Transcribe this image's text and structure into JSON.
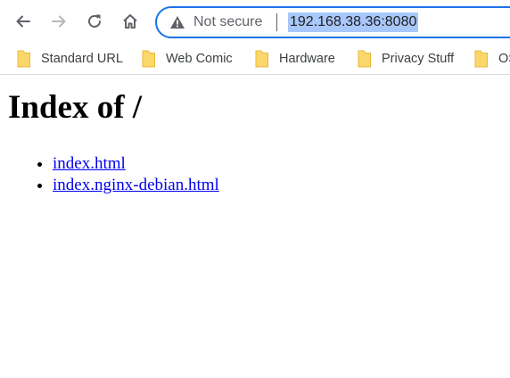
{
  "browser": {
    "security_label": "Not secure",
    "url": "192.168.38.36:8080",
    "accent_color": "#1a73e8",
    "icons": [
      "back-arrow-icon",
      "forward-arrow-icon",
      "reload-icon",
      "home-icon",
      "warning-triangle-icon",
      "folder-icon"
    ]
  },
  "bookmarks": [
    {
      "label": "Standard URL"
    },
    {
      "label": "Web Comic"
    },
    {
      "label": "Hardware"
    },
    {
      "label": "Privacy Stuff"
    },
    {
      "label": "OS"
    }
  ],
  "page": {
    "heading": "Index of /",
    "files": [
      {
        "name": "index.html"
      },
      {
        "name": "index.nginx-debian.html"
      }
    ],
    "link_color": "#0000ee"
  }
}
